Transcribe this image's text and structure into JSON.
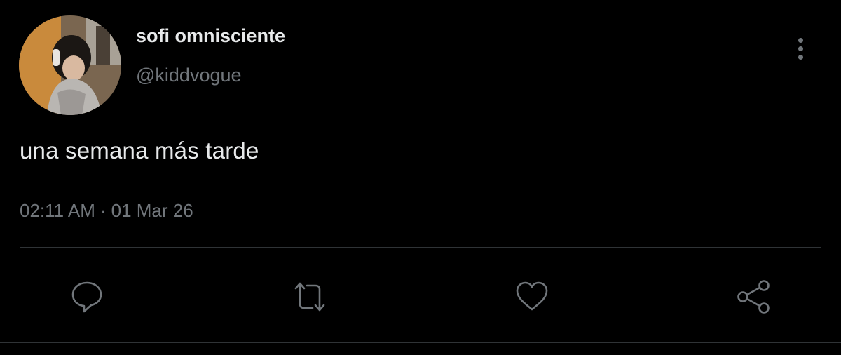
{
  "tweet": {
    "display_name": "sofi omnisciente",
    "handle": "@kiddvogue",
    "text": "una semana más tarde",
    "time": "02:11 AM",
    "separator": "·",
    "date": "01 Mar 26"
  },
  "icons": {
    "more": "more-vertical-icon",
    "reply": "reply-icon",
    "retweet": "retweet-icon",
    "like": "heart-icon",
    "share": "share-icon"
  },
  "colors": {
    "background": "#000000",
    "primary_text": "#e7e9ea",
    "secondary_text": "#71767b",
    "divider": "#2f3336"
  }
}
